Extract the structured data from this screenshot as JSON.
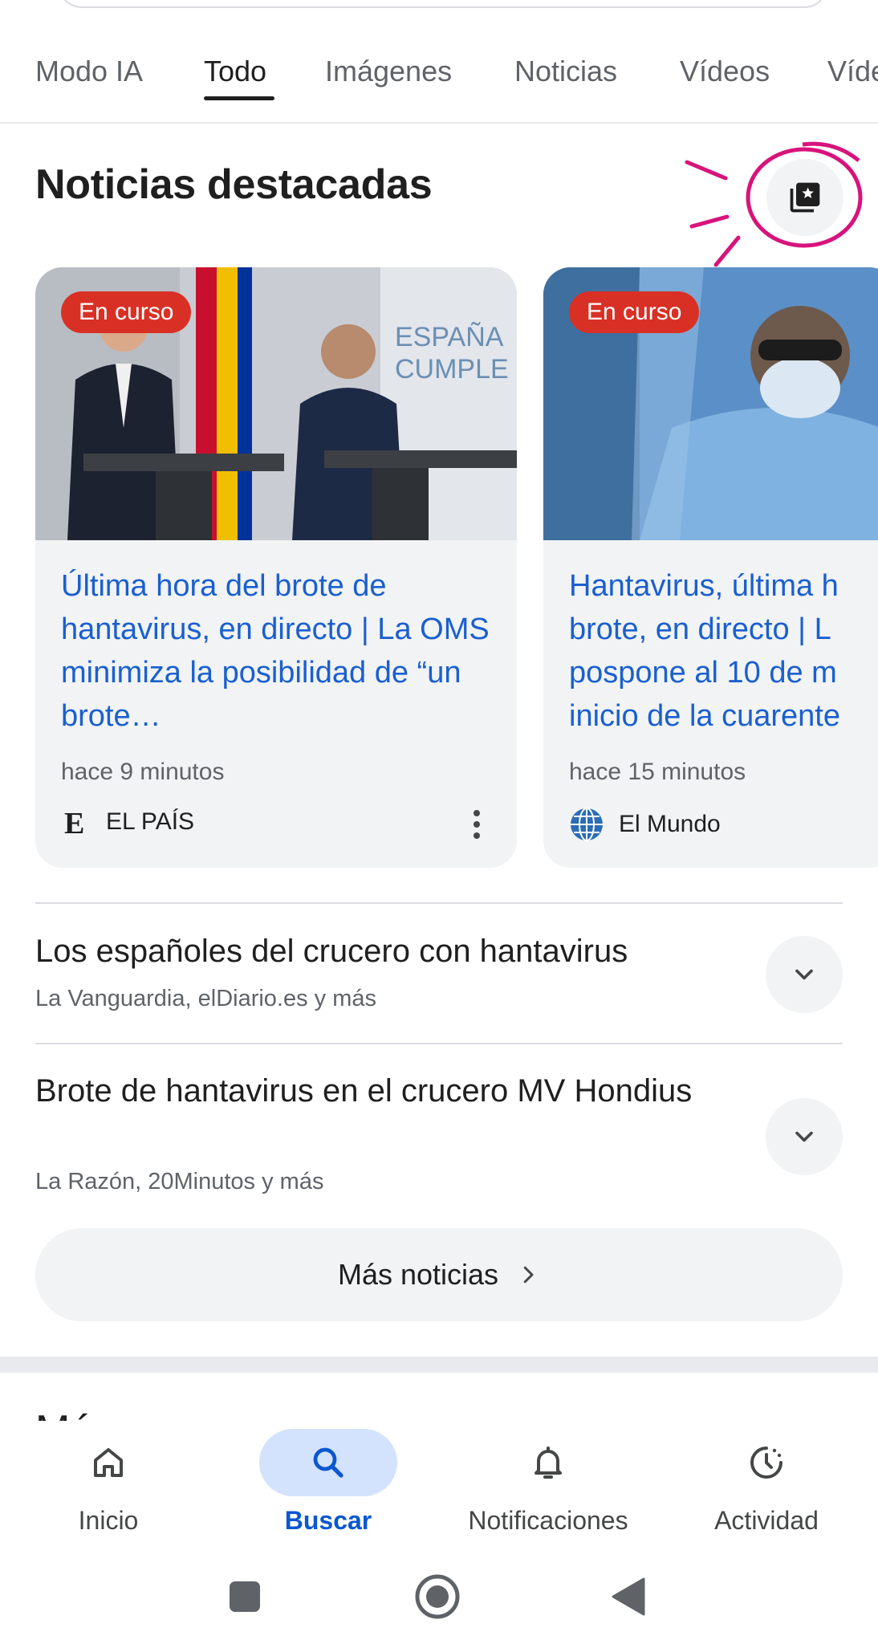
{
  "tabs": [
    {
      "label": "Modo IA",
      "active": false
    },
    {
      "label": "Todo",
      "active": true
    },
    {
      "label": "Imágenes",
      "active": false
    },
    {
      "label": "Noticias",
      "active": false
    },
    {
      "label": "Vídeos",
      "active": false
    },
    {
      "label": "Víde",
      "active": false
    }
  ],
  "section": {
    "title": "Noticias destacadas",
    "collection_icon": "collections-star-icon"
  },
  "cards": [
    {
      "badge": "En curso",
      "title": "Última hora del brote de hantavirus, en directo | La OMS minimiza la posibilidad de “un brote…",
      "time": "hace 9 minutos",
      "source": "EL PAÍS",
      "source_icon": "el-pais-logo-icon",
      "image_text": "ESPAÑA CUMPLE"
    },
    {
      "badge": "En curso",
      "title_lines": [
        "Hantavirus, última h",
        "brote, en directo | L",
        "pospone al 10 de m",
        "inicio de la cuarente"
      ],
      "time": "hace 15 minutos",
      "source": "El Mundo",
      "source_icon": "el-mundo-logo-icon"
    }
  ],
  "stories": [
    {
      "title": "Los españoles del crucero con hantavirus",
      "sources": "La Vanguardia, elDiario.es y más"
    },
    {
      "title": "Brote de hantavirus en el crucero MV Hondius",
      "sources": "La Razón, 20Minutos y más"
    }
  ],
  "more_news": {
    "label": "Más noticias"
  },
  "partial_next_section": "Má",
  "bottom_nav": [
    {
      "label": "Inicio",
      "icon": "home-icon",
      "active": false
    },
    {
      "label": "Buscar",
      "icon": "search-icon",
      "active": true
    },
    {
      "label": "Notificaciones",
      "icon": "bell-icon",
      "active": false
    },
    {
      "label": "Actividad",
      "icon": "activity-history-icon",
      "active": false
    }
  ],
  "system_nav": [
    "recents-icon",
    "home-circle-icon",
    "back-triangle-icon"
  ],
  "colors": {
    "link_blue": "#1a5fd0",
    "badge_red": "#d93025",
    "active_nav_pill": "#d3e3fd",
    "annotation_magenta": "#d8137b"
  }
}
